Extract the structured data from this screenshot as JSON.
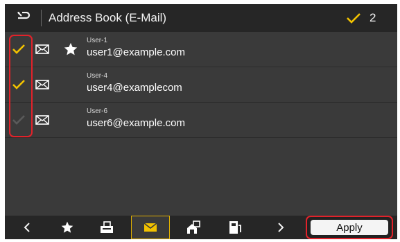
{
  "header": {
    "back_icon": "back-arrow-icon",
    "title": "Address Book (E-Mail)",
    "selected_count": "2",
    "check_color": "#f2c200"
  },
  "contacts": [
    {
      "name": "User-1",
      "email": "user1@example.com",
      "checked": true,
      "favorite": true
    },
    {
      "name": "User-4",
      "email": "user4@examplecom",
      "checked": true,
      "favorite": false
    },
    {
      "name": "User-6",
      "email": "user6@example.com",
      "checked": false,
      "favorite": false
    }
  ],
  "footer": {
    "buttons": [
      {
        "icon": "chevron-left-icon"
      },
      {
        "icon": "star-icon"
      },
      {
        "icon": "fax-icon"
      },
      {
        "icon": "email-icon",
        "active": true
      },
      {
        "icon": "file-server-icon"
      },
      {
        "icon": "shared-folder-icon"
      },
      {
        "icon": "chevron-right-icon"
      }
    ],
    "apply_label": "Apply"
  },
  "colors": {
    "background": "#3a3a3a",
    "bar": "#262626",
    "highlight": "#e2222a",
    "active_border": "#e0b000"
  }
}
